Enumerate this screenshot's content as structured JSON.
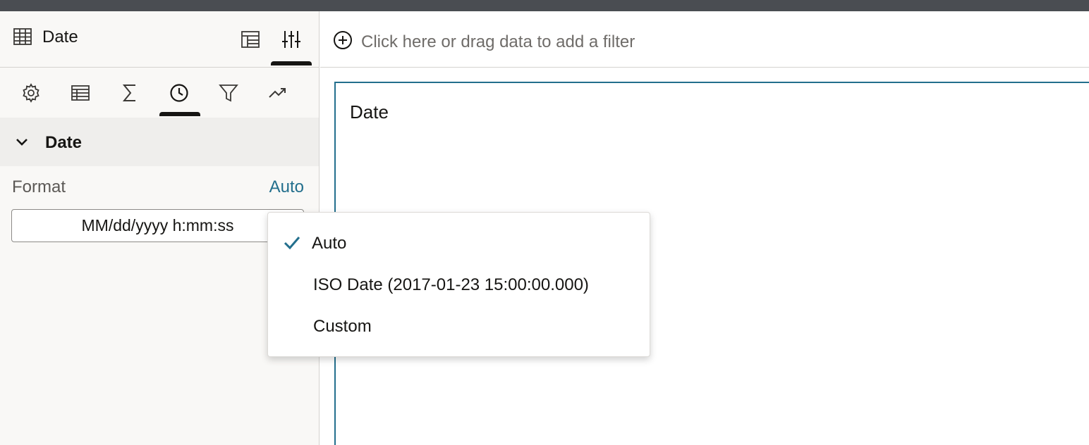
{
  "panel": {
    "title": "Date",
    "tabs": [
      {
        "icon": "gear-icon"
      },
      {
        "icon": "table-icon"
      },
      {
        "icon": "sigma-icon"
      },
      {
        "icon": "clock-icon",
        "selected": true
      },
      {
        "icon": "filter-icon"
      },
      {
        "icon": "trend-icon"
      }
    ],
    "section": {
      "label": "Date",
      "format_label": "Format",
      "format_value": "Auto",
      "format_input": "MM/dd/yyyy h:mm:ss"
    }
  },
  "filter_bar": {
    "placeholder": "Click here or drag data to add a filter"
  },
  "canvas": {
    "title": "Date"
  },
  "menu": {
    "items": [
      {
        "label": "Auto",
        "checked": true
      },
      {
        "label": "ISO Date (2017-01-23 15:00:00.000)",
        "checked": false
      },
      {
        "label": "Custom",
        "checked": false
      }
    ]
  },
  "colors": {
    "accent": "#236f8d",
    "topbar": "#4a4d52",
    "panel_bg": "#f9f8f6",
    "section_bg": "#efeeec"
  }
}
